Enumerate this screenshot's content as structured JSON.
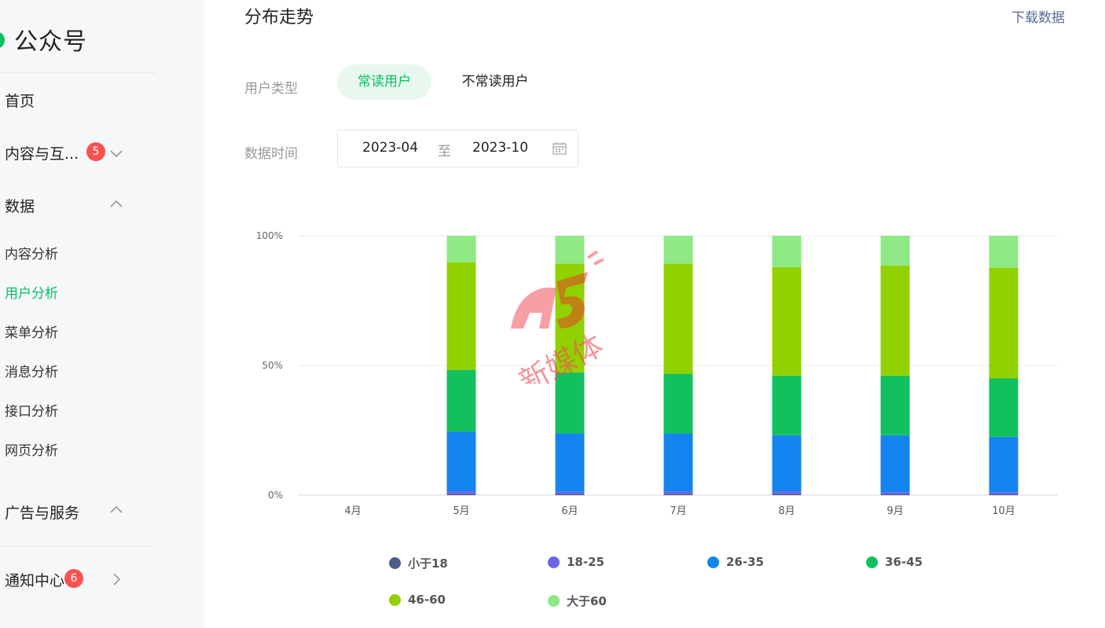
{
  "sidebar": {
    "brand": "公众号",
    "items": [
      {
        "label": "首页"
      },
      {
        "label": "内容与互...",
        "badge": "5"
      },
      {
        "label": "数据"
      },
      {
        "label": "广告与服务"
      },
      {
        "label": "通知中心",
        "badge": "6"
      }
    ],
    "data_sub": [
      "内容分析",
      "用户分析",
      "菜单分析",
      "消息分析",
      "接口分析",
      "网页分析"
    ],
    "active_sub": "用户分析"
  },
  "header": {
    "title": "分布走势",
    "download": "下载数据"
  },
  "filters": {
    "user_type_label": "用户类型",
    "user_type_options": [
      "常读用户",
      "不常读用户"
    ],
    "user_type_selected": "常读用户",
    "date_label": "数据时间",
    "date_start": "2023-04",
    "date_sep": "至",
    "date_end": "2023-10"
  },
  "colors": {
    "accent": "#07c160",
    "badge": "#fa5151",
    "link": "#576b95"
  },
  "chart_data": {
    "type": "bar",
    "stacked": true,
    "categories": [
      "4月",
      "5月",
      "6月",
      "7月",
      "8月",
      "9月",
      "10月"
    ],
    "y_ticks": [
      "0%",
      "50%",
      "100%"
    ],
    "ylim": [
      0,
      100
    ],
    "series": [
      {
        "name": "小于18",
        "color": "#4c5e8a",
        "values": [
          0,
          0.5,
          0.5,
          0.5,
          0.5,
          0.3,
          0.3
        ]
      },
      {
        "name": "18-25",
        "color": "#6c64e6",
        "values": [
          0,
          1.0,
          0.8,
          0.9,
          1.0,
          0.8,
          0.8
        ]
      },
      {
        "name": "26-35",
        "color": "#1485ee",
        "values": [
          0,
          23.0,
          22.5,
          22.4,
          21.6,
          22.0,
          21.4
        ]
      },
      {
        "name": "36-45",
        "color": "#12c15e",
        "values": [
          0,
          23.8,
          23.5,
          23.0,
          23.0,
          23.0,
          22.5
        ]
      },
      {
        "name": "46-60",
        "color": "#91d100",
        "values": [
          0,
          41.5,
          42.0,
          42.5,
          41.8,
          42.4,
          42.7
        ]
      },
      {
        "name": "大于60",
        "color": "#8ee884",
        "values": [
          0,
          10.2,
          10.7,
          10.7,
          12.1,
          11.5,
          12.3
        ]
      }
    ],
    "legend": "bottom"
  },
  "watermark": "新媒体"
}
